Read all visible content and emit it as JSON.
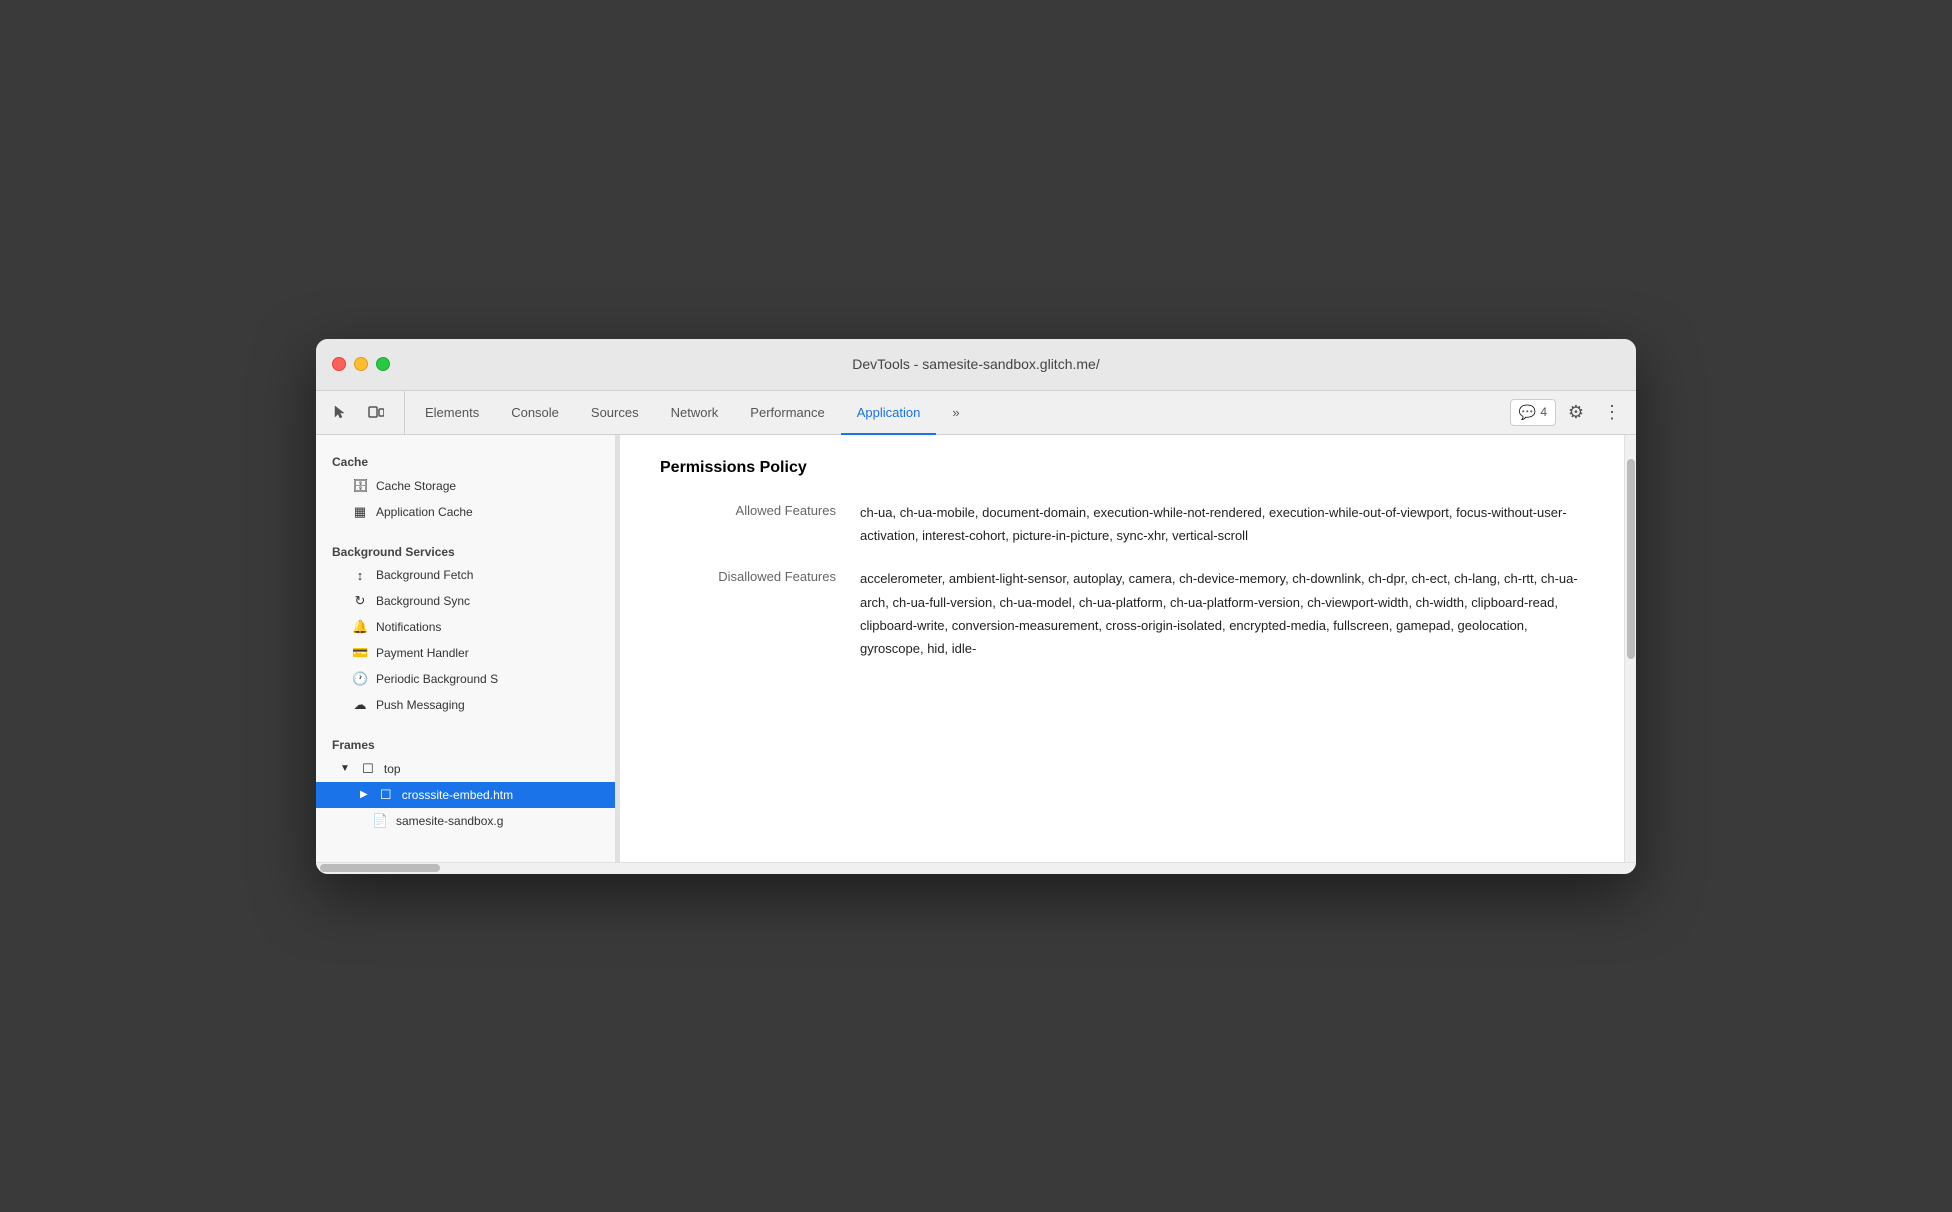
{
  "window": {
    "title": "DevTools - samesite-sandbox.glitch.me/"
  },
  "toolbar": {
    "tabs": [
      {
        "id": "elements",
        "label": "Elements",
        "active": false
      },
      {
        "id": "console",
        "label": "Console",
        "active": false
      },
      {
        "id": "sources",
        "label": "Sources",
        "active": false
      },
      {
        "id": "network",
        "label": "Network",
        "active": false
      },
      {
        "id": "performance",
        "label": "Performance",
        "active": false
      },
      {
        "id": "application",
        "label": "Application",
        "active": true
      }
    ],
    "more_tabs_icon": "»",
    "badge_count": "4",
    "settings_icon": "⚙",
    "more_icon": "⋮"
  },
  "sidebar": {
    "cache_section_label": "Cache",
    "cache_storage_label": "Cache Storage",
    "application_cache_label": "Application Cache",
    "bg_services_label": "Background Services",
    "bg_fetch_label": "Background Fetch",
    "bg_sync_label": "Background Sync",
    "notifications_label": "Notifications",
    "payment_handler_label": "Payment Handler",
    "periodic_bg_label": "Periodic Background S",
    "push_messaging_label": "Push Messaging",
    "frames_label": "Frames",
    "top_label": "top",
    "crosssite_label": "crosssite-embed.htm",
    "samesite_label": "samesite-sandbox.g"
  },
  "content": {
    "title": "Permissions Policy",
    "allowed_features_label": "Allowed Features",
    "allowed_features_value": "ch-ua, ch-ua-mobile, document-domain, execution-while-not-rendered, execution-while-out-of-viewport, focus-without-user-activation, interest-cohort, picture-in-picture, sync-xhr, vertical-scroll",
    "disallowed_features_label": "Disallowed Features",
    "disallowed_features_value": "accelerometer, ambient-light-sensor, autoplay, camera, ch-device-memory, ch-downlink, ch-dpr, ch-ect, ch-lang, ch-rtt, ch-ua-arch, ch-ua-full-version, ch-ua-model, ch-ua-platform, ch-ua-platform-version, ch-viewport-width, ch-width, clipboard-read, clipboard-write, conversion-measurement, cross-origin-isolated, encrypted-media, fullscreen, gamepad, geolocation, gyroscope, hid, idle-"
  }
}
